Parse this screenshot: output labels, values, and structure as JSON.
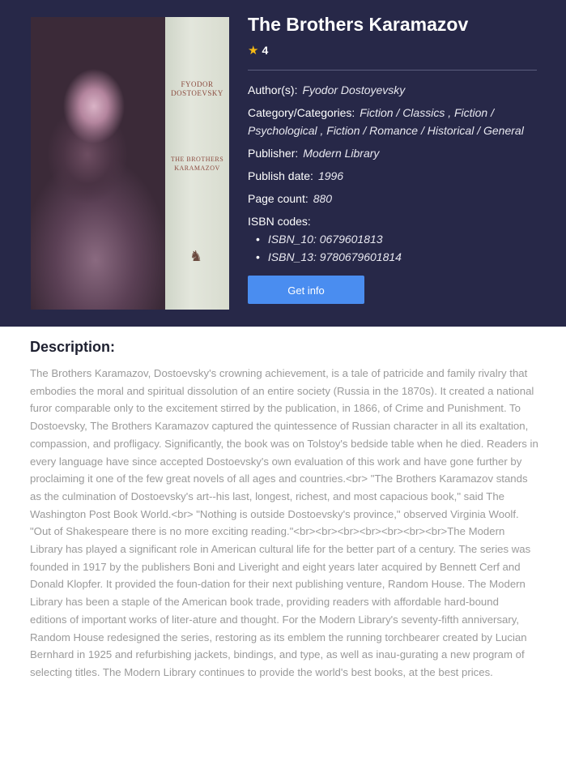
{
  "book": {
    "title": "The Brothers Karamazov",
    "rating": "4",
    "cover": {
      "spine_author": "FYODOR DOSTOEVSKY",
      "spine_title": "THE BROTHERS KARAMAZOV"
    },
    "fields": {
      "author_label": "Author(s):",
      "author_value": "Fyodor Dostoyevsky",
      "category_label": "Category/Categories:",
      "category_value": "Fiction / Classics ,   Fiction / Psychological ,   Fiction / Romance / Historical / General",
      "publisher_label": "Publisher:",
      "publisher_value": "Modern Library",
      "publish_date_label": "Publish date:",
      "publish_date_value": "1996",
      "page_count_label": "Page count:",
      "page_count_value": "880",
      "isbn_label": "ISBN codes:",
      "isbn_10": "ISBN_10: 0679601813",
      "isbn_13": "ISBN_13: 9780679601814"
    },
    "get_info_label": "Get info"
  },
  "description": {
    "heading": "Description:",
    "text": "The Brothers Karamazov, Dostoevsky's crowning achievement, is a tale of patricide and family rivalry that embodies the moral and spiritual dissolution of an entire society (Russia in the 1870s). It created a national furor comparable only to the excitement stirred by the publication, in 1866, of Crime and Punishment. To Dostoevsky, The Brothers Karamazov captured the quintessence of Russian character in all its exaltation, compassion, and profligacy. Significantly, the book was on Tolstoy's bedside table when he died. Readers in every language have since accepted Dostoevsky's own evaluation of this work and have gone further by proclaiming it one of the few great novels of all ages and countries.<br> \"The Brothers Karamazov stands as the culmination of Dostoevsky's art--his last, longest, richest, and most capacious book,\" said The Washington Post Book World.<br> \"Nothing is outside Dostoevsky's province,\" observed Virginia Woolf. \"Out of Shakespeare there is no more exciting reading.\"<br><br><br><br><br><br><br>The Modern Library has played a significant role in American cultural life for the better part of a century. The series was founded in 1917 by the publishers Boni and Liveright and eight years later acquired by Bennett Cerf and Donald Klopfer. It provided the foun-dation for their next publishing venture, Random House. The Modern Library has been a staple of the American book trade, providing readers with affordable hard-bound editions of important works of liter-ature and thought. For the Modern Library's seventy-fifth anniversary, Random House redesigned the series, restoring as its emblem the running torchbearer created by Lucian Bernhard in 1925 and refurbishing jackets, bindings, and type, as well as inau-gurating a new program of selecting titles. The Modern Library continues to provide the world's best books, at the best prices."
  },
  "colors": {
    "header_bg": "#272848",
    "button_bg": "#4a8df0",
    "star": "#f5b914",
    "description_text": "#9a9a9a"
  }
}
